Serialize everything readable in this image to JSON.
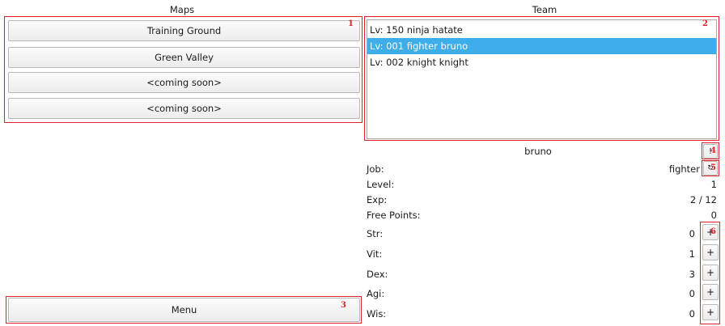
{
  "maps": {
    "title": "Maps",
    "items": [
      "Training Ground",
      "Green Valley",
      "<coming soon>",
      "<coming soon>"
    ]
  },
  "team": {
    "title": "Team",
    "members": [
      "Lv: 150 ninja hatate",
      "Lv: 001 fighter bruno",
      "Lv: 002 knight knight"
    ],
    "selected_index": 1
  },
  "menu": {
    "label": "Menu"
  },
  "character": {
    "name": "bruno",
    "job_label": "Job:",
    "job_value": "fighter",
    "level_label": "Level:",
    "level_value": "1",
    "exp_label": "Exp:",
    "exp_value": "2 / 12",
    "free_label": "Free Points:",
    "free_value": "0",
    "stats": [
      {
        "label": "Str:",
        "value": "0",
        "button": "+"
      },
      {
        "label": "Vit:",
        "value": "1",
        "button": "+"
      },
      {
        "label": "Dex:",
        "value": "3",
        "button": "+"
      },
      {
        "label": "Agi:",
        "value": "0",
        "button": "+"
      },
      {
        "label": "Wis:",
        "value": "0",
        "button": "+"
      }
    ]
  },
  "annotations": [
    "1",
    "2",
    "3",
    "4",
    "5",
    "6"
  ],
  "colors": {
    "annotation": "#e0202a",
    "selection": "#3daee9"
  }
}
